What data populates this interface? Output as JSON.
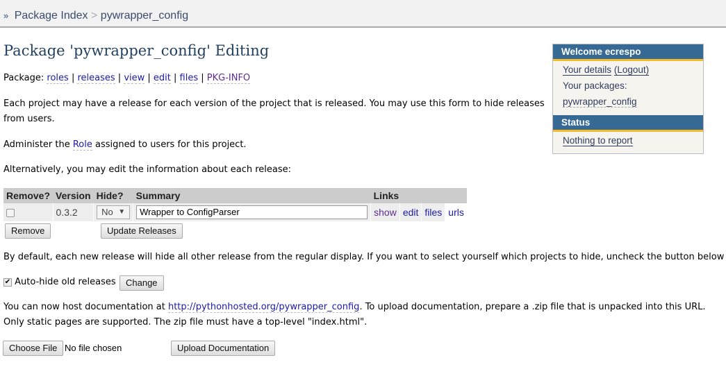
{
  "breadcrumb": {
    "root": "Package Index",
    "separator": ">",
    "current": "pywrapper_config"
  },
  "title": "Package 'pywrapper_config' Editing",
  "package_nav": {
    "label": "Package:",
    "links": [
      "roles",
      "releases",
      "view",
      "edit",
      "files",
      "PKG-INFO"
    ]
  },
  "intro": "Each project may have a release for each version of the project that is released. You may use this form to hide releases from users.",
  "role_text": {
    "before": "Administer the ",
    "link": "Role",
    "after": " assigned to users for this project."
  },
  "alt_text": "Alternatively, you may edit the information about each release:",
  "table": {
    "headers": [
      "Remove?",
      "Version",
      "Hide?",
      "Summary",
      "Links"
    ],
    "rows": [
      {
        "version": "0.3.2",
        "hide": "No",
        "summary": "Wrapper to ConfigParser",
        "links": [
          "show",
          "edit",
          "files",
          "urls"
        ]
      }
    ]
  },
  "buttons": {
    "remove": "Remove",
    "update": "Update Releases",
    "change": "Change",
    "choose_file": "Choose File",
    "upload": "Upload Documentation"
  },
  "autohide_text": "By default, each new release will hide all other release from the regular display. If you want to select yourself which projects to hide, uncheck the button below",
  "autohide_label": "Auto-hide old releases",
  "autohide_checked": true,
  "docs": {
    "before": "You can now host documentation at ",
    "link": "http://pythonhosted.org/pywrapper_config",
    "after": ". To upload documentation, prepare a .zip file that is unpacked into this URL.",
    "line2": "Only static pages are supported. The zip file must have a top-level \"index.html\"."
  },
  "file_status": "No file chosen",
  "sidebar": {
    "welcome": "Welcome ecrespo",
    "details": "Your details",
    "logout": "(Logout)",
    "packages_label": "Your packages:",
    "package": "pywrapper_config",
    "status_title": "Status",
    "status_text": "Nothing to report"
  }
}
